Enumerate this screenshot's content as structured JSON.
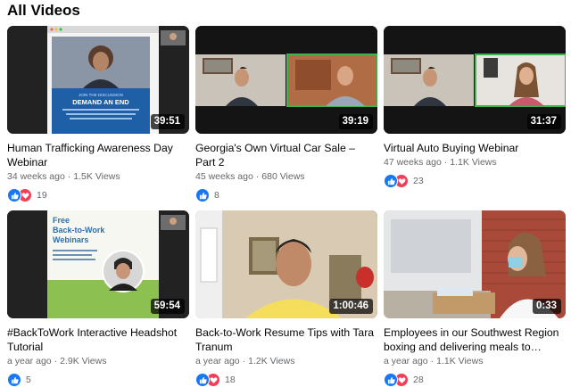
{
  "section": {
    "title": "All Videos"
  },
  "colors": {
    "like": "#1877f2",
    "love": "#f33e58",
    "meta": "#65676b"
  },
  "icons": {
    "like": "thumbs-up-icon",
    "love": "heart-icon"
  },
  "videos": [
    {
      "duration": "39:51",
      "thumb_texts": [
        "JOIN THE DISCUSSION",
        "DEMAND AN END"
      ],
      "title": "Human Trafficking Awareness Day Webinar",
      "age": "34 weeks ago",
      "views": "1.5K Views",
      "reactions": [
        "like",
        "love"
      ],
      "reaction_count": "19"
    },
    {
      "duration": "39:19",
      "title": "Georgia's Own Virtual Car Sale – Part 2",
      "age": "45 weeks ago",
      "views": "680 Views",
      "reactions": [
        "like"
      ],
      "reaction_count": "8"
    },
    {
      "duration": "31:37",
      "title": "Virtual Auto Buying Webinar",
      "age": "47 weeks ago",
      "views": "1.1K Views",
      "reactions": [
        "like",
        "love"
      ],
      "reaction_count": "23"
    },
    {
      "duration": "59:54",
      "thumb_texts": [
        "Free",
        "Back-to-Work",
        "Webinars"
      ],
      "title": "#BackToWork Interactive Headshot Tutorial",
      "age": "a year ago",
      "views": "2.9K Views",
      "reactions": [
        "like"
      ],
      "reaction_count": "5"
    },
    {
      "duration": "1:00:46",
      "title": "Back-to-Work Resume Tips with Tara Tranum",
      "age": "a year ago",
      "views": "1.2K Views",
      "reactions": [
        "like",
        "love"
      ],
      "reaction_count": "18"
    },
    {
      "duration": "0:33",
      "title": "Employees in our Southwest Region boxing and delivering meals to…",
      "age": "a year ago",
      "views": "1.1K Views",
      "reactions": [
        "like",
        "love"
      ],
      "reaction_count": "28"
    }
  ]
}
